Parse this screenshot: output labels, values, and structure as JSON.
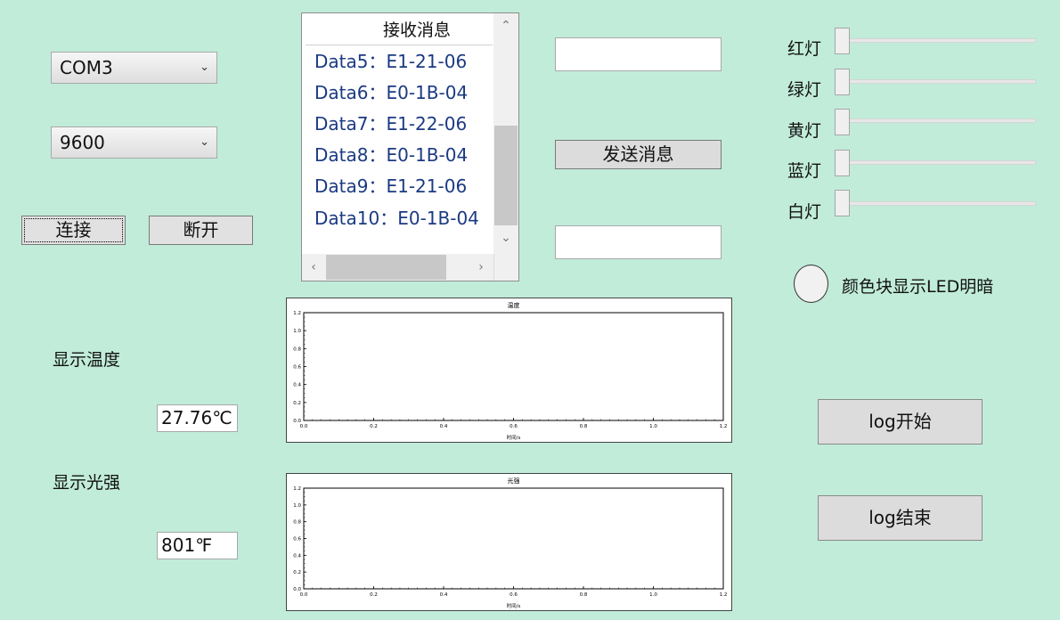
{
  "serial": {
    "port": {
      "selected": "COM3"
    },
    "baud": {
      "selected": "9600"
    },
    "connect_label": "连接",
    "disconnect_label": "断开"
  },
  "receive": {
    "header": "接收消息",
    "messages": [
      "Data5：E1-21-06",
      "Data6：E0-1B-04",
      "Data7：E1-22-06",
      "Data8：E0-1B-04",
      "Data9：E1-21-06",
      "Data10：E0-1B-04"
    ]
  },
  "send": {
    "input_value": "",
    "button_label": "发送消息",
    "output_value": ""
  },
  "lights": [
    {
      "label": "红灯",
      "value": 0
    },
    {
      "label": "绿灯",
      "value": 0
    },
    {
      "label": "黄灯",
      "value": 0
    },
    {
      "label": "蓝灯",
      "value": 0
    },
    {
      "label": "白灯",
      "value": 0
    }
  ],
  "led": {
    "label": "颜色块显示LED明暗",
    "color": "#f1f1f1"
  },
  "temperature": {
    "label": "显示温度",
    "value": "27.76℃"
  },
  "light_intensity": {
    "label": "显示光强",
    "value": "801℉"
  },
  "log": {
    "start_label": "log开始",
    "stop_label": "log结束"
  },
  "chart_data": [
    {
      "type": "line",
      "title": "温度",
      "xlabel": "时间/s",
      "ylabel": "",
      "xlim": [
        0,
        1.2
      ],
      "ylim": [
        0,
        1.2
      ],
      "xticks": [
        "0.0",
        "0.2",
        "0.4",
        "0.6",
        "0.8",
        "1.0",
        "1.2"
      ],
      "yticks": [
        "0.0",
        "0.2",
        "0.4",
        "0.6",
        "0.8",
        "1.0",
        "1.2"
      ],
      "series": [
        {
          "values": []
        }
      ]
    },
    {
      "type": "line",
      "title": "光强",
      "xlabel": "时间/s",
      "ylabel": "",
      "xlim": [
        0,
        1.2
      ],
      "ylim": [
        0,
        1.2
      ],
      "xticks": [
        "0.0",
        "0.2",
        "0.4",
        "0.6",
        "0.8",
        "1.0",
        "1.2"
      ],
      "yticks": [
        "0.0",
        "0.2",
        "0.4",
        "0.6",
        "0.8",
        "1.0",
        "1.2"
      ],
      "series": [
        {
          "values": []
        }
      ]
    }
  ]
}
